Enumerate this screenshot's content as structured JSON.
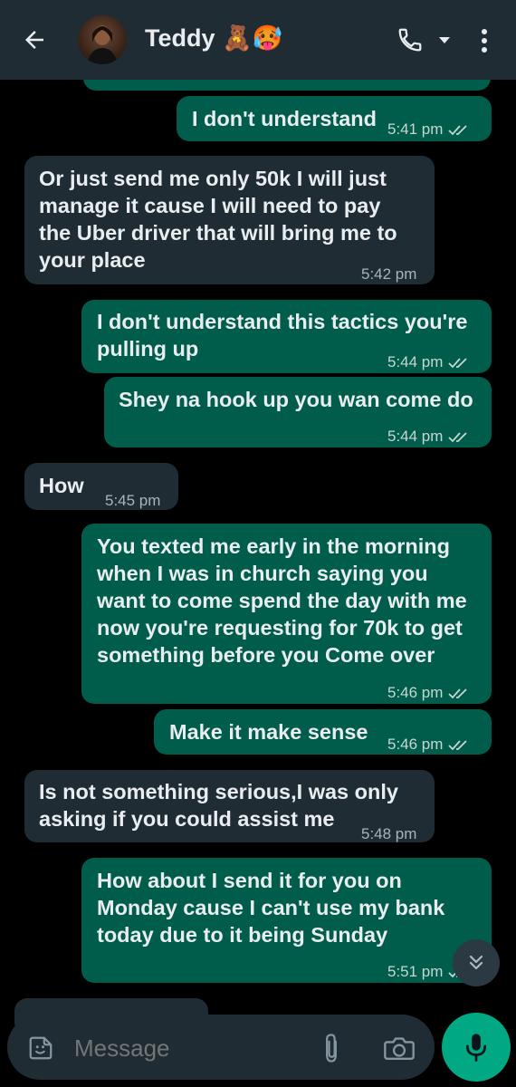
{
  "header": {
    "contact_name": "Teddy 🧸🥵",
    "back_icon": "arrow-back-icon",
    "call_icon": "phone-icon",
    "dropdown_icon": "caret-down-icon",
    "menu_icon": "more-vert-icon"
  },
  "messages": [
    {
      "direction": "out",
      "text": "I don't understand",
      "time": "5:41 pm",
      "status": "read"
    },
    {
      "direction": "in",
      "text": [
        "Or just send me only 50k I will just",
        "manage it cause I will need to pay",
        "the Uber driver that will bring me to",
        "your place"
      ],
      "time": "5:42 pm"
    },
    {
      "direction": "out",
      "text": [
        "I don't understand this tactics you're",
        "pulling up"
      ],
      "time": "5:44 pm",
      "status": "read"
    },
    {
      "direction": "out",
      "text": "Shey na hook up you wan come do",
      "time": "5:44 pm",
      "status": "read"
    },
    {
      "direction": "in",
      "text": "How",
      "time": "5:45 pm"
    },
    {
      "direction": "out",
      "text": [
        "You texted me early in the morning",
        "when I was in church saying you",
        "want to come spend the day with me",
        "now you're requesting for 70k to get",
        "something before you Come over"
      ],
      "time": "5:46 pm",
      "status": "read"
    },
    {
      "direction": "out",
      "text": "Make it make sense",
      "time": "5:46 pm",
      "status": "read"
    },
    {
      "direction": "in",
      "text": [
        "Is not something serious,I was only",
        "asking if you could assist me"
      ],
      "time": "5:48 pm"
    },
    {
      "direction": "out",
      "text": [
        "How about I send it for you on",
        "Monday cause I can't use my bank",
        "today due to it being Sunday"
      ],
      "time": "5:51 pm",
      "status": "read"
    }
  ],
  "composer": {
    "placeholder": "Message",
    "emoji_icon": "sticker-icon",
    "attach_icon": "paperclip-icon",
    "camera_icon": "camera-icon",
    "mic_icon": "microphone-icon",
    "scroll_icon": "double-chevron-down-icon"
  },
  "colors": {
    "background": "#000000",
    "header": "#1f2c34",
    "outgoing_bubble": "#005c4b",
    "incoming_bubble": "#1f2c34",
    "accent": "#00a884"
  }
}
